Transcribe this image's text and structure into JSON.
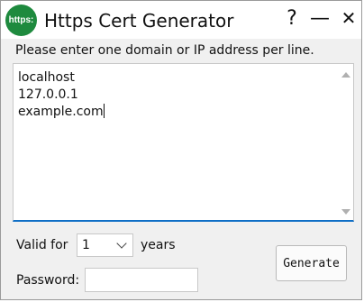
{
  "window": {
    "title": "Https Cert Generator",
    "app_icon_text": "https:",
    "help_glyph": "?",
    "minimize_glyph": "—",
    "close_glyph": "✕"
  },
  "main": {
    "prompt": "Please enter one domain or IP address per line.",
    "domains": [
      "localhost",
      "127.0.0.1",
      "example.com"
    ]
  },
  "form": {
    "valid_label": "Valid for",
    "years_value": "1",
    "years_label": "years",
    "password_label": "Password:",
    "password_value": "",
    "generate_label": "Generate"
  },
  "colors": {
    "accent": "#0f6fc6",
    "app_icon": "#1e8a3e"
  }
}
